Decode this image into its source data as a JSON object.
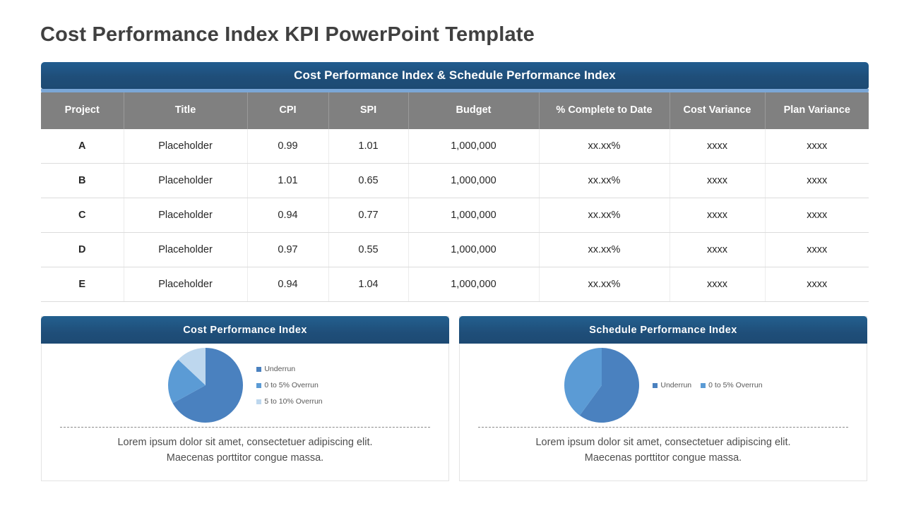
{
  "slide": {
    "title": "Cost Performance Index KPI PowerPoint Template"
  },
  "colors": {
    "header_blue": "#1f4e79",
    "accent_blue": "#7ba7d7",
    "table_header_gray": "#808080",
    "pie_dark": "#4a81bf",
    "pie_medium": "#5b9bd5",
    "pie_light": "#bdd7ee"
  },
  "table": {
    "title": "Cost Performance Index & Schedule Performance Index",
    "columns": [
      "Project",
      "Title",
      "CPI",
      "SPI",
      "Budget",
      "% Complete to Date",
      "Cost Variance",
      "Plan Variance"
    ],
    "rows": [
      [
        "A",
        "Placeholder",
        "0.99",
        "1.01",
        "1,000,000",
        "xx.xx%",
        "xxxx",
        "xxxx"
      ],
      [
        "B",
        "Placeholder",
        "1.01",
        "0.65",
        "1,000,000",
        "xx.xx%",
        "xxxx",
        "xxxx"
      ],
      [
        "C",
        "Placeholder",
        "0.94",
        "0.77",
        "1,000,000",
        "xx.xx%",
        "xxxx",
        "xxxx"
      ],
      [
        "D",
        "Placeholder",
        "0.97",
        "0.55",
        "1,000,000",
        "xx.xx%",
        "xxxx",
        "xxxx"
      ],
      [
        "E",
        "Placeholder",
        "0.94",
        "1.04",
        "1,000,000",
        "xx.xx%",
        "xxxx",
        "xxxx"
      ]
    ]
  },
  "panels": [
    {
      "title": "Cost Performance Index",
      "caption_line1": "Lorem ipsum dolor sit amet, consectetuer adipiscing elit.",
      "caption_line2": "Maecenas porttitor congue massa.",
      "legend_layout": "stacked",
      "chart_data": {
        "type": "pie",
        "title": "Cost Performance Index",
        "labels": [
          "Underrun",
          "0 to 5% Overrun",
          "5 to 10% Overrun"
        ],
        "values": [
          67,
          20,
          13
        ],
        "colors": [
          "#4a81bf",
          "#5b9bd5",
          "#bdd7ee"
        ],
        "legend_position": "right",
        "start_angle": 0,
        "direction": "clockwise"
      }
    },
    {
      "title": "Schedule Performance Index",
      "caption_line1": "Lorem ipsum dolor sit amet, consectetuer adipiscing elit.",
      "caption_line2": "Maecenas porttitor congue massa.",
      "legend_layout": "inline",
      "chart_data": {
        "type": "pie",
        "title": "Schedule Performance Index",
        "labels": [
          "Underrun",
          "0 to 5% Overrun"
        ],
        "values": [
          60,
          40
        ],
        "colors": [
          "#4a81bf",
          "#5b9bd5"
        ],
        "legend_position": "right",
        "start_angle": 0,
        "direction": "clockwise"
      }
    }
  ]
}
